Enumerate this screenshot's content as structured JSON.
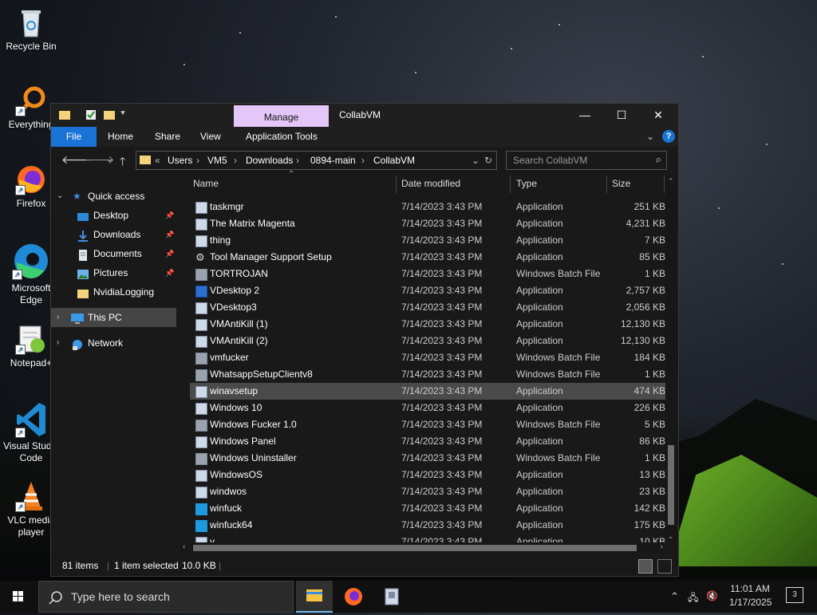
{
  "desktop": {
    "icons": [
      {
        "label": "Recycle Bin",
        "icon": "recycle-bin-icon"
      },
      {
        "label": "Everything",
        "icon": "everything-search-icon"
      },
      {
        "label": "Firefox",
        "icon": "firefox-icon"
      },
      {
        "label": "Microsoft Edge",
        "icon": "edge-icon"
      },
      {
        "label": "Notepad+",
        "icon": "notepadpp-icon"
      },
      {
        "label": "Visual Studio Code",
        "icon": "vscode-icon"
      },
      {
        "label": "VLC media player",
        "icon": "vlc-icon"
      }
    ]
  },
  "window": {
    "title": "CollabVM",
    "manage_tab": "Manage",
    "ribbon": {
      "file": "File",
      "home": "Home",
      "share": "Share",
      "view": "View",
      "app_tools": "Application Tools",
      "help": "?"
    },
    "controls": {
      "minimize": "—",
      "maximize": "☐",
      "close": "✕"
    },
    "address": {
      "prefix": "«",
      "crumbs": [
        "Users",
        "VM5",
        "Downloads",
        "0894-main",
        "CollabVM"
      ]
    },
    "search_placeholder": "Search CollabVM",
    "nav": {
      "quick_access": "Quick access",
      "items": [
        {
          "label": "Desktop",
          "pinned": true
        },
        {
          "label": "Downloads",
          "pinned": true
        },
        {
          "label": "Documents",
          "pinned": true
        },
        {
          "label": "Pictures",
          "pinned": true
        },
        {
          "label": "NvidiaLogging",
          "pinned": false
        }
      ],
      "this_pc": "This PC",
      "network": "Network"
    },
    "columns": {
      "name": "Name",
      "date": "Date modified",
      "type": "Type",
      "size": "Size"
    },
    "files": [
      {
        "name": "taskmgr",
        "date": "7/14/2023 3:43 PM",
        "type": "Application",
        "size": "251 KB",
        "icon": "app"
      },
      {
        "name": "The Matrix Magenta",
        "date": "7/14/2023 3:43 PM",
        "type": "Application",
        "size": "4,231 KB",
        "icon": "app"
      },
      {
        "name": "thing",
        "date": "7/14/2023 3:43 PM",
        "type": "Application",
        "size": "7 KB",
        "icon": "app"
      },
      {
        "name": "Tool Manager Support Setup",
        "date": "7/14/2023 3:43 PM",
        "type": "Application",
        "size": "85 KB",
        "icon": "gear"
      },
      {
        "name": "TORTROJAN",
        "date": "7/14/2023 3:43 PM",
        "type": "Windows Batch File",
        "size": "1 KB",
        "icon": "bat"
      },
      {
        "name": "VDesktop 2",
        "date": "7/14/2023 3:43 PM",
        "type": "Application",
        "size": "2,757 KB",
        "icon": "blue"
      },
      {
        "name": "VDesktop3",
        "date": "7/14/2023 3:43 PM",
        "type": "Application",
        "size": "2,056 KB",
        "icon": "app"
      },
      {
        "name": "VMAntiKill (1)",
        "date": "7/14/2023 3:43 PM",
        "type": "Application",
        "size": "12,130 KB",
        "icon": "app"
      },
      {
        "name": "VMAntiKill (2)",
        "date": "7/14/2023 3:43 PM",
        "type": "Application",
        "size": "12,130 KB",
        "icon": "app"
      },
      {
        "name": "vmfucker",
        "date": "7/14/2023 3:43 PM",
        "type": "Windows Batch File",
        "size": "184 KB",
        "icon": "bat"
      },
      {
        "name": "WhatsappSetupClientv8",
        "date": "7/14/2023 3:43 PM",
        "type": "Windows Batch File",
        "size": "1 KB",
        "icon": "bat"
      },
      {
        "name": "winavsetup",
        "date": "7/14/2023 3:43 PM",
        "type": "Application",
        "size": "474 KB",
        "icon": "app",
        "selected": true
      },
      {
        "name": "Windows 10",
        "date": "7/14/2023 3:43 PM",
        "type": "Application",
        "size": "226 KB",
        "icon": "app"
      },
      {
        "name": "Windows Fucker 1.0",
        "date": "7/14/2023 3:43 PM",
        "type": "Windows Batch File",
        "size": "5 KB",
        "icon": "bat"
      },
      {
        "name": "Windows Panel",
        "date": "7/14/2023 3:43 PM",
        "type": "Application",
        "size": "86 KB",
        "icon": "app"
      },
      {
        "name": "Windows Uninstaller",
        "date": "7/14/2023 3:43 PM",
        "type": "Windows Batch File",
        "size": "1 KB",
        "icon": "bat"
      },
      {
        "name": "WindowsOS",
        "date": "7/14/2023 3:43 PM",
        "type": "Application",
        "size": "13 KB",
        "icon": "app"
      },
      {
        "name": "windwos",
        "date": "7/14/2023 3:43 PM",
        "type": "Application",
        "size": "23 KB",
        "icon": "app"
      },
      {
        "name": "winfuck",
        "date": "7/14/2023 3:43 PM",
        "type": "Application",
        "size": "142 KB",
        "icon": "win"
      },
      {
        "name": "winfuck64",
        "date": "7/14/2023 3:43 PM",
        "type": "Application",
        "size": "175 KB",
        "icon": "win"
      },
      {
        "name": "y",
        "date": "7/14/2023 3:43 PM",
        "type": "Application",
        "size": "10 KB",
        "icon": "app"
      }
    ],
    "status": {
      "items": "81 items",
      "selected": "1 item selected",
      "size": "10.0 KB"
    }
  },
  "taskbar": {
    "search_placeholder": "Type here to search",
    "time": "11:01 AM",
    "date": "1/17/2025",
    "notifications": "3"
  },
  "colors": {
    "accent": "#1a73d6",
    "manage_tab": "#e4c7f8",
    "window_bg": "#191919"
  }
}
